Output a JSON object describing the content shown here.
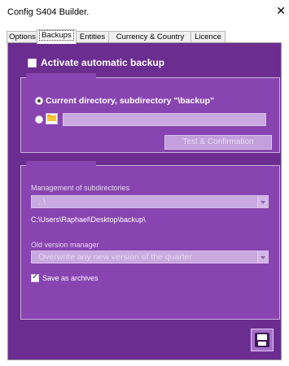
{
  "window": {
    "title": "Config S404 Builder.",
    "close_glyph": "✕"
  },
  "tabs": [
    {
      "label": "Options"
    },
    {
      "label": "Backups",
      "active": true
    },
    {
      "label": "Entities"
    },
    {
      "label": "Currency & Country"
    },
    {
      "label": "Licence"
    }
  ],
  "backups": {
    "activate_label": "Activate automatic backup",
    "activate_checked": false,
    "directory_group": {
      "legend": "",
      "option_current": "Current directory, subdirectory \"\\backup\"",
      "option_current_selected": true,
      "option_custom_selected": false,
      "custom_path_value": "",
      "test_button": "Test & Confirmation"
    },
    "manager_group": {
      "legend": "",
      "subdir_label": "Management of subdirectories",
      "subdir_value": "..\\",
      "path_text": "C:\\Users\\Raphael\\Desktop\\backup\\",
      "version_label": "Old version manager",
      "version_value": "Overwrite any new version of the quarter",
      "save_archives_label": "Save as archives",
      "save_archives_checked": true
    }
  },
  "colors": {
    "panel": "#6b2d8f",
    "group": "#8844b0",
    "disabled_field": "#c9a9e0"
  },
  "icons": {
    "folder": "folder-icon",
    "save": "floppy-disk-icon"
  }
}
